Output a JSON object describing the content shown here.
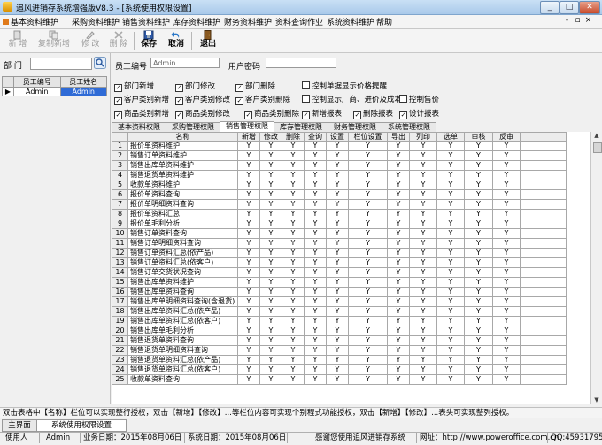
{
  "window": {
    "title": "追风进销存系统增强版V8.3 - [系统使用权限设置]",
    "min": "_",
    "max": "□",
    "close": "✕",
    "mdi_min": "-",
    "mdi_max": "▫",
    "mdi_close": "×"
  },
  "menu": [
    "基本资料维护",
    "采购资料维护",
    "销售资料维护",
    "库存资料维护",
    "财务资料维护",
    "资料查询作业",
    "系统资料维护",
    "帮助"
  ],
  "toolbar": {
    "add": "新 增",
    "copy_add": "复制新增",
    "edit": "修 改",
    "delete": "删 除",
    "save": "保存",
    "cancel": "取消",
    "exit": "退出"
  },
  "left": {
    "dept_label": "部 门",
    "dept_value": "",
    "col_code": "员工编号",
    "col_name": "员工姓名",
    "rows": [
      [
        "Admin",
        "Admin"
      ]
    ]
  },
  "form": {
    "emp_code_label": "员工编号",
    "emp_code_value": "Admin",
    "pwd_label": "用户密码",
    "pwd_value": ""
  },
  "perms": [
    {
      "label": "部门新增",
      "checked": true
    },
    {
      "label": "部门修改",
      "checked": true
    },
    {
      "label": "部门删除",
      "checked": true
    },
    {
      "label": "控制单据显示价格提醒",
      "checked": false
    },
    {
      "label": "客户类别新增",
      "checked": true
    },
    {
      "label": "客户类别修改",
      "checked": true
    },
    {
      "label": "客户类别删除",
      "checked": true
    },
    {
      "label": "控制显示厂商、进价及成本",
      "checked": false
    },
    {
      "label": "控制售价",
      "checked": false
    },
    {
      "label": "商品类别新增",
      "checked": true
    },
    {
      "label": "商品类别修改",
      "checked": true
    },
    {
      "label": "商品类别删除",
      "checked": true
    },
    {
      "label": "新增报表",
      "checked": true
    },
    {
      "label": "删除报表",
      "checked": true
    },
    {
      "label": "设计报表",
      "checked": true
    }
  ],
  "tabs": [
    "基本资料权限",
    "采购管理权限",
    "销售管理权限",
    "库存管理权限",
    "财务管理权限",
    "系统管理权限"
  ],
  "active_tab": 2,
  "grid": {
    "headers": [
      "名称",
      "新增",
      "修改",
      "删除",
      "查询",
      "设置",
      "栏位设置",
      "导出",
      "列印",
      "选单",
      "审核",
      "反审"
    ],
    "flag": "Y",
    "rows": [
      "报价单资料维护",
      "销售订单资料维护",
      "销售出库单资料维护",
      "销售退货单资料维护",
      "收款单资料维护",
      "报价单资料查询",
      "报价单明细资料查询",
      "报价单资料汇总",
      "报价单毛利分析",
      "销售订单资料查询",
      "销售订单明细资料查询",
      "销售订单资料汇总(依产品)",
      "销售订单资料汇总(依客户)",
      "销售订单交货状况查询",
      "销售出库单资料维护",
      "销售出库单资料查询",
      "销售出库单明细资料查询(含退货)",
      "销售出库单资料汇总(依产品)",
      "销售出库单资料汇总(依客户)",
      "销售出库单毛利分析",
      "销售退货单资料查询",
      "销售退货单明细资料查询",
      "销售退货单资料汇总(依产品)",
      "销售退货单资料汇总(依客户)",
      "收款单资料查询"
    ]
  },
  "hint": "双击表格中【名称】栏位可以实现整行授权，双击【新增】【修改】...等栏位内容可实现个别程式功能授权，双击【新增】【修改】...表头可实现整列授权。",
  "doc_tabs": [
    "主界面",
    "系统使用权限设置"
  ],
  "status": {
    "user_label": "使用人",
    "user": "Admin",
    "biz_date": "业务日期：2015年08月06日",
    "sys_date": "系统日期：2015年08月06日",
    "thanks": "感谢您使用追风进销存系统",
    "url": "网址：http://www.poweroffice.com.cn",
    "qq": "QQ:45931795"
  }
}
